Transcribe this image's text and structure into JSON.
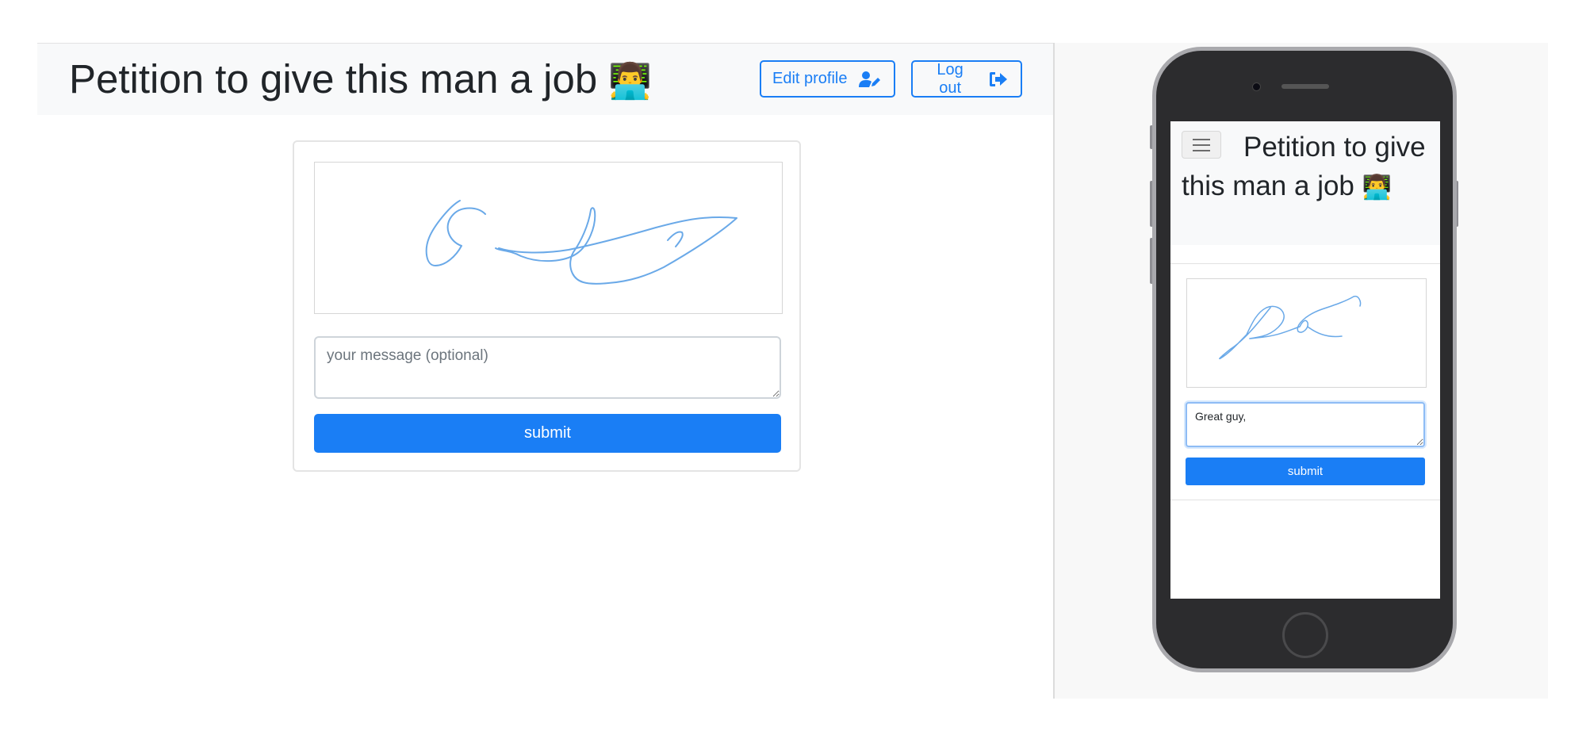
{
  "header": {
    "title": "Petition to give this man a job",
    "title_emoji": "👨‍💻",
    "edit_profile_label": "Edit profile",
    "edit_profile_icon": "user-edit-icon",
    "logout_label": "Log out",
    "logout_icon": "sign-out-icon"
  },
  "form": {
    "message_placeholder": "your message (optional)",
    "message_value": "",
    "submit_label": "submit"
  },
  "mobile": {
    "menu_icon": "hamburger-menu-icon",
    "title": "Petition to give this man a job",
    "title_emoji": "👨‍💻",
    "message_value": "Great guy,",
    "submit_label": "submit"
  },
  "colors": {
    "accent": "#1a7ef5",
    "signature_stroke": "#6aa9e8",
    "navbar_bg": "#f8f9fa"
  }
}
